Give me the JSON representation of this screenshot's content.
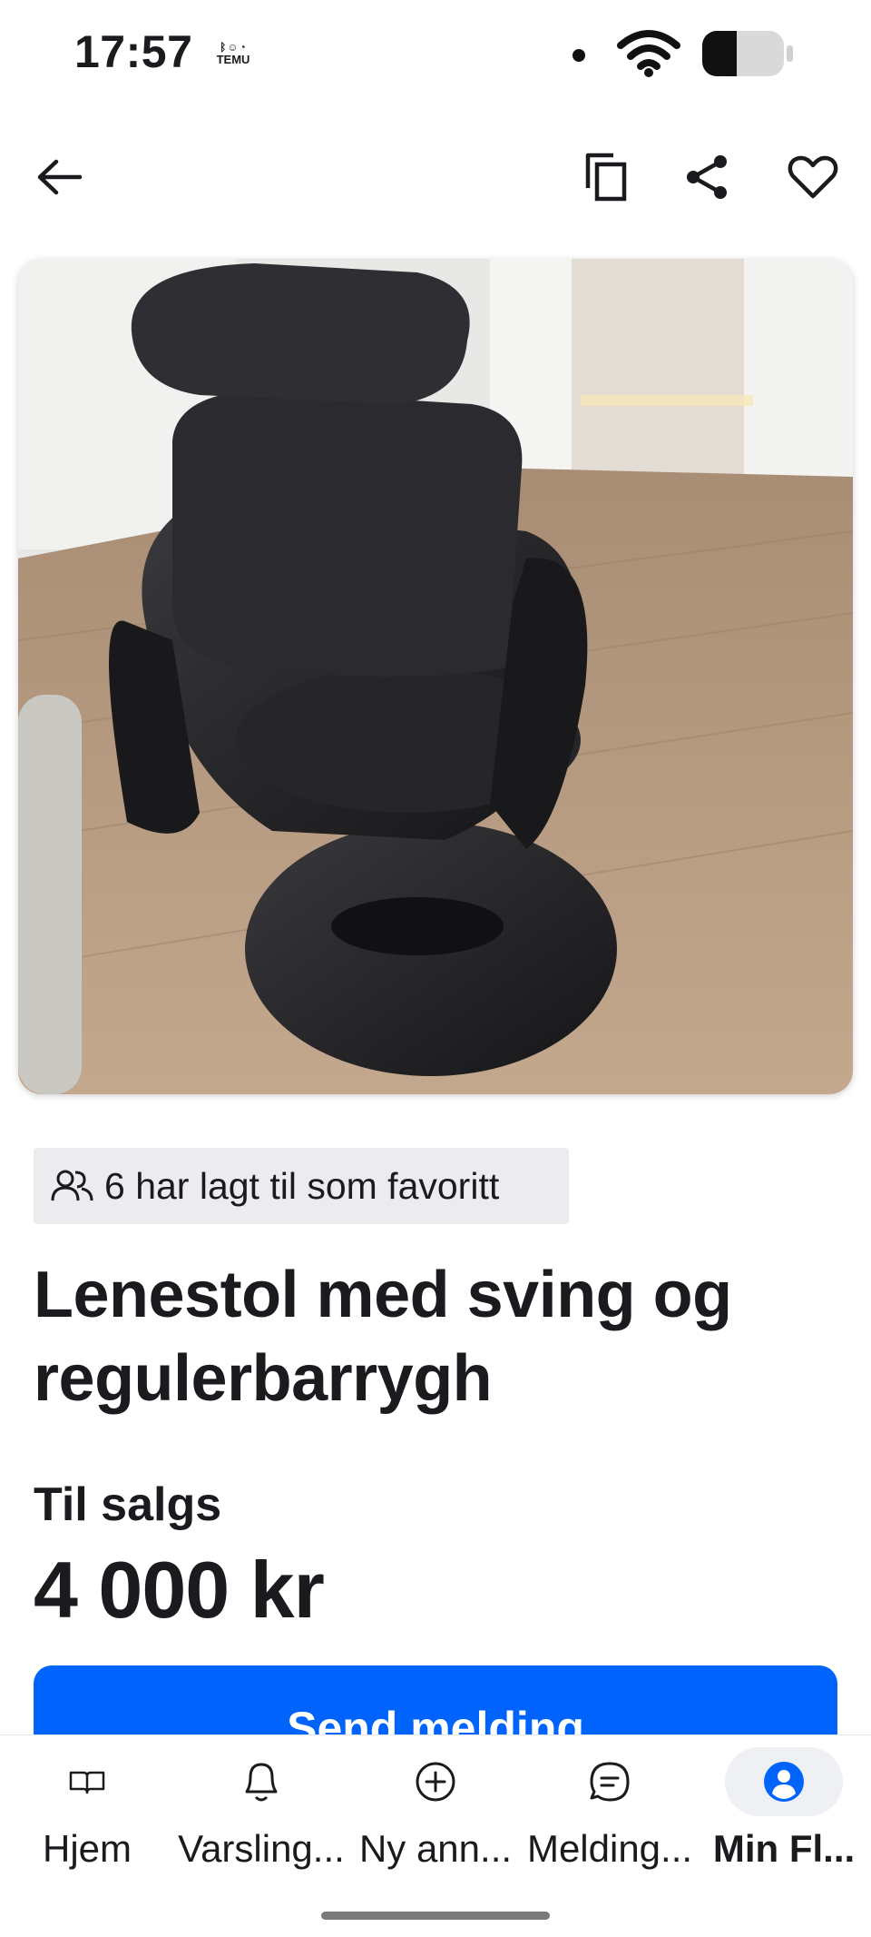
{
  "status_bar": {
    "time": "17:57",
    "notification_app": "TEMU"
  },
  "top_nav": {
    "back_icon": "arrow-left-icon",
    "copy_icon": "copy-icon",
    "share_icon": "share-icon",
    "favorite_icon": "heart-icon"
  },
  "listing": {
    "image_description_icon": "listing-photo",
    "favorites_text": "6 har lagt til som favoritt",
    "title": "Lenestol med sving og regulerbarrygh",
    "sale_type": "Til salgs",
    "price": "4 000 kr",
    "send_button_label": "Send melding"
  },
  "bottom_nav": {
    "items": [
      {
        "label": "Hjem",
        "icon": "book-icon"
      },
      {
        "label": "Varsling...",
        "icon": "bell-icon"
      },
      {
        "label": "Ny ann...",
        "icon": "plus-circle-icon"
      },
      {
        "label": "Melding...",
        "icon": "chat-icon"
      },
      {
        "label": "Min Fl...",
        "icon": "profile-icon",
        "active": true
      }
    ]
  },
  "colors": {
    "primary": "#0063fb",
    "text": "#1b1b1f",
    "badge_bg": "#ececef"
  }
}
